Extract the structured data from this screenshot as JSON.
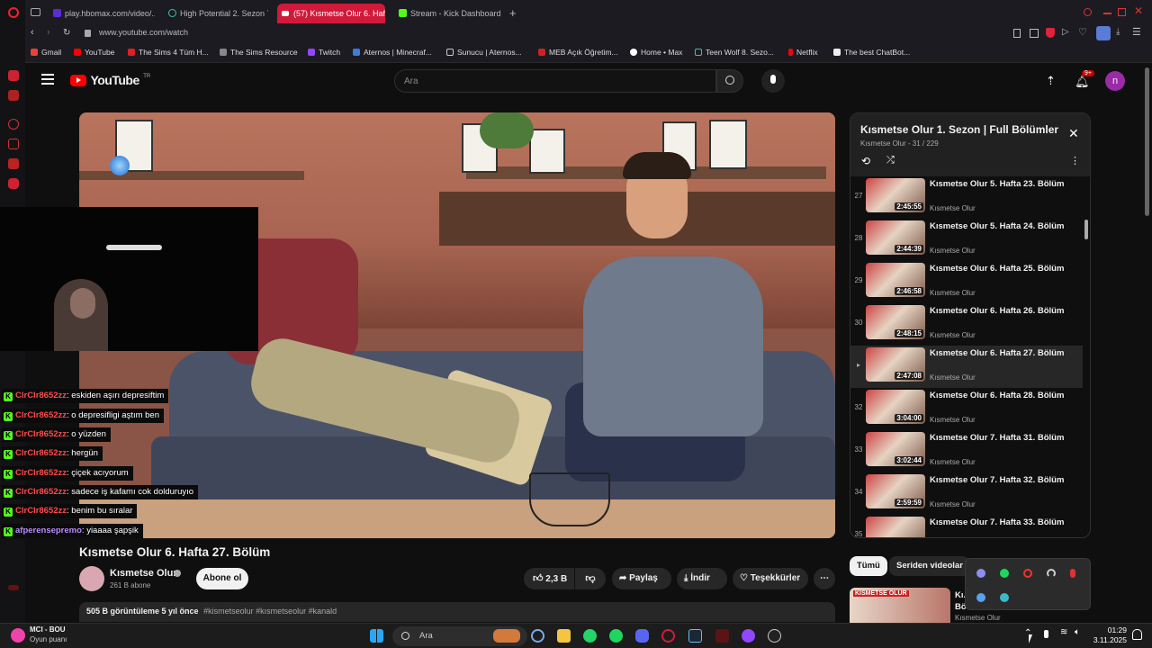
{
  "browser": {
    "tabs": [
      {
        "label": "play.hbomax.com/video/..."
      },
      {
        "label": "High Potential 2. Sezon 7..."
      },
      {
        "label": "(57) Kısmetse Olur 6. Haf..."
      },
      {
        "label": "Stream - Kick Dashboard"
      }
    ],
    "url": "www.youtube.com/watch",
    "bookmarks": [
      "Gmail",
      "YouTube",
      "The Sims 4 Tüm H...",
      "The Sims Resource",
      "Twitch",
      "Aternos | Minecraf...",
      "Sunucu | Aternos...",
      "MEB Açık Öğretim...",
      "Home • Max",
      "Teen Wolf 8. Sezo...",
      "Netflix",
      "The best ChatBot..."
    ]
  },
  "youtube": {
    "logo_text": "YouTube",
    "region": "TR",
    "search_placeholder": "Ara",
    "notification_count": "9+",
    "avatar_letter": "n"
  },
  "video": {
    "title": "Kısmetse Olur 6. Hafta 27. Bölüm",
    "channel": "Kısmetse Olur",
    "subscribers": "261 B abone",
    "subscribe_label": "Abone ol",
    "likes": "2,3 B",
    "share_label": "Paylaş",
    "download_label": "İndir",
    "thanks_label": "Teşekkürler",
    "views_line": "505 B görüntüleme  5 yıl önce",
    "hashtags": "#kismetseolur #kısmetseolur #kanald"
  },
  "chat": [
    {
      "user": "ClrClr8652zz",
      "text": ": eskiden aşırı depresiftim",
      "color": "red"
    },
    {
      "user": "ClrClr8652zz",
      "text": ": o depresifligi aştım ben",
      "color": "red"
    },
    {
      "user": "ClrClr8652zz",
      "text": ": o yüzden",
      "color": "red"
    },
    {
      "user": "ClrClr8652zz",
      "text": ": hergün",
      "color": "red"
    },
    {
      "user": "ClrClr8652zz",
      "text": ": çiçek acıyorum",
      "color": "red"
    },
    {
      "user": "ClrClr8652zz",
      "text": ": sadece iş kafamı cok dolduruyıo",
      "color": "red"
    },
    {
      "user": "ClrClr8652zz",
      "text": ": benim bu sıralar",
      "color": "red"
    },
    {
      "user": "afperensepremo",
      "text": ": yiaaaa şapşik",
      "color": "purple"
    }
  ],
  "playlist": {
    "title": "Kısmetse Olur 1. Sezon | Full Bölümler",
    "subtitle": "Kısmetse Olur - 31 / 229",
    "items": [
      {
        "idx": "27",
        "title": "Kısmetse Olur 5. Hafta 23. Bölüm",
        "channel": "Kısmetse Olur",
        "duration": "2:45:55"
      },
      {
        "idx": "28",
        "title": "Kısmetse Olur 5. Hafta 24. Bölüm",
        "channel": "Kısmetse Olur",
        "duration": "2:44:39"
      },
      {
        "idx": "29",
        "title": "Kısmetse Olur 6. Hafta 25. Bölüm",
        "channel": "Kısmetse Olur",
        "duration": "2:46:58"
      },
      {
        "idx": "30",
        "title": "Kısmetse Olur 6. Hafta 26. Bölüm",
        "channel": "Kısmetse Olur",
        "duration": "2:48:15"
      },
      {
        "idx": "▸",
        "title": "Kısmetse Olur 6. Hafta 27. Bölüm",
        "channel": "Kısmetse Olur",
        "duration": "2:47:08"
      },
      {
        "idx": "32",
        "title": "Kısmetse Olur 6. Hafta 28. Bölüm",
        "channel": "Kısmetse Olur",
        "duration": "3:04:00"
      },
      {
        "idx": "33",
        "title": "Kısmetse Olur 7. Hafta 31. Bölüm",
        "channel": "Kısmetse Olur",
        "duration": "3:02:44"
      },
      {
        "idx": "34",
        "title": "Kısmetse Olur 7. Hafta 32. Bölüm",
        "channel": "Kısmetse Olur",
        "duration": "2:59:59"
      },
      {
        "idx": "35",
        "title": "Kısmetse Olur 7. Hafta 33. Bölüm",
        "channel": "Kısmetse Olur",
        "duration": ""
      }
    ]
  },
  "chips": [
    "Tümü",
    "Seriden videolar"
  ],
  "recommended": {
    "title_partial": "Kı... Bö...",
    "thumb_text": "KISMETSE OLUR",
    "channel": "Kısmetse Olur"
  },
  "taskbar": {
    "widget_title": "MCI - BOU",
    "widget_sub": "Oyun puanı",
    "search_label": "Ara",
    "time": "01:29",
    "date": "3.11.2025"
  },
  "colors": {
    "accent": "#d11a3a",
    "yt_red": "#ff0000",
    "kick_green": "#53fc18",
    "chat_red": "#ff4a4a",
    "chat_purple": "#b98bff"
  }
}
